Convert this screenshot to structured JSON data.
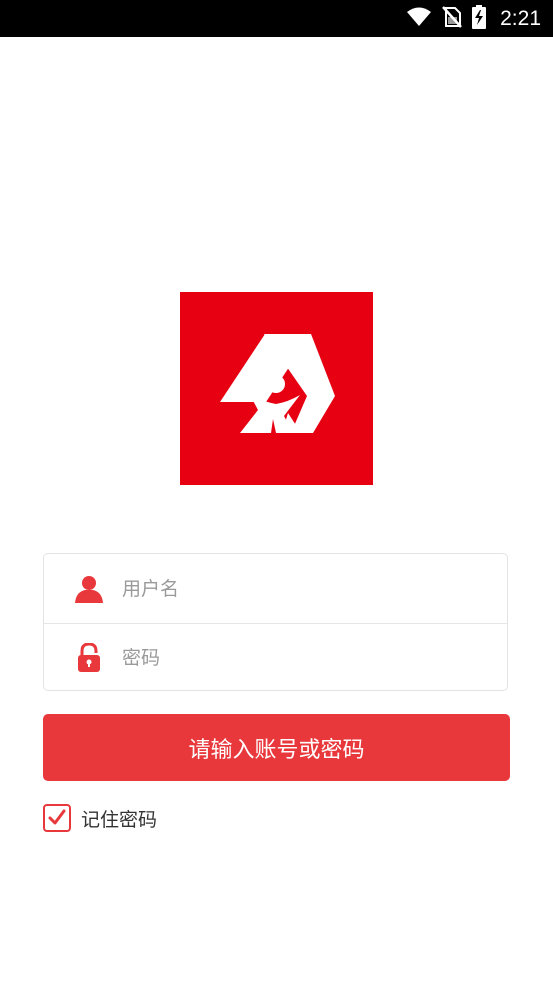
{
  "status_bar": {
    "time": "2:21",
    "icons": [
      "wifi-icon",
      "no-sim-icon",
      "battery-charging-icon"
    ]
  },
  "logo": {
    "brand_color": "#e60012"
  },
  "form": {
    "username_placeholder": "用户名",
    "password_placeholder": "密码",
    "submit_label": "请输入账号或密码",
    "remember_label": "记住密码",
    "remember_checked": true
  },
  "colors": {
    "accent": "#e8383c",
    "icon": "#e8383c"
  }
}
